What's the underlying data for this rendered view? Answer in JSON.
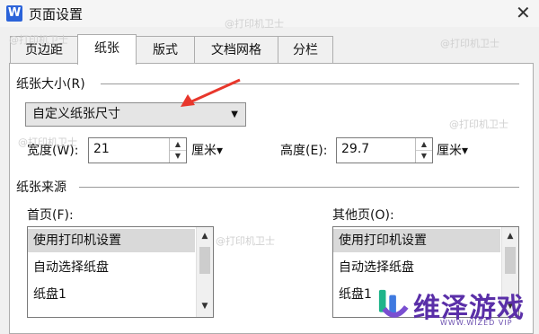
{
  "window": {
    "app_icon": "W",
    "title": "页面设置",
    "close_glyph": "✕"
  },
  "tabs": [
    {
      "label": "页边距"
    },
    {
      "label": "纸张"
    },
    {
      "label": "版式"
    },
    {
      "label": "文档网格"
    },
    {
      "label": "分栏"
    }
  ],
  "active_tab": "纸张",
  "paper_size": {
    "section_label": "纸张大小(R)",
    "selected": "自定义纸张尺寸",
    "dropdown_arrow": "▼",
    "width_label": "宽度(W):",
    "width_value": "21",
    "width_unit": "厘米▾",
    "height_label": "高度(E):",
    "height_value": "29.7",
    "height_unit": "厘米▾"
  },
  "paper_source": {
    "section_label": "纸张来源",
    "first_page": {
      "label": "首页(F):",
      "items": [
        "使用打印机设置",
        "自动选择纸盘",
        "纸盘1"
      ]
    },
    "other_pages": {
      "label": "其他页(O):",
      "items": [
        "使用打印机设置",
        "自动选择纸盘",
        "纸盘1"
      ]
    }
  },
  "annotation": {
    "arrow_color": "#e8372c"
  },
  "watermarks": {
    "text": "@打印机卫士"
  },
  "brand": {
    "name": "维泽游戏",
    "sub": "WWW.WIZED VIP",
    "color": "#5a2fa8"
  }
}
